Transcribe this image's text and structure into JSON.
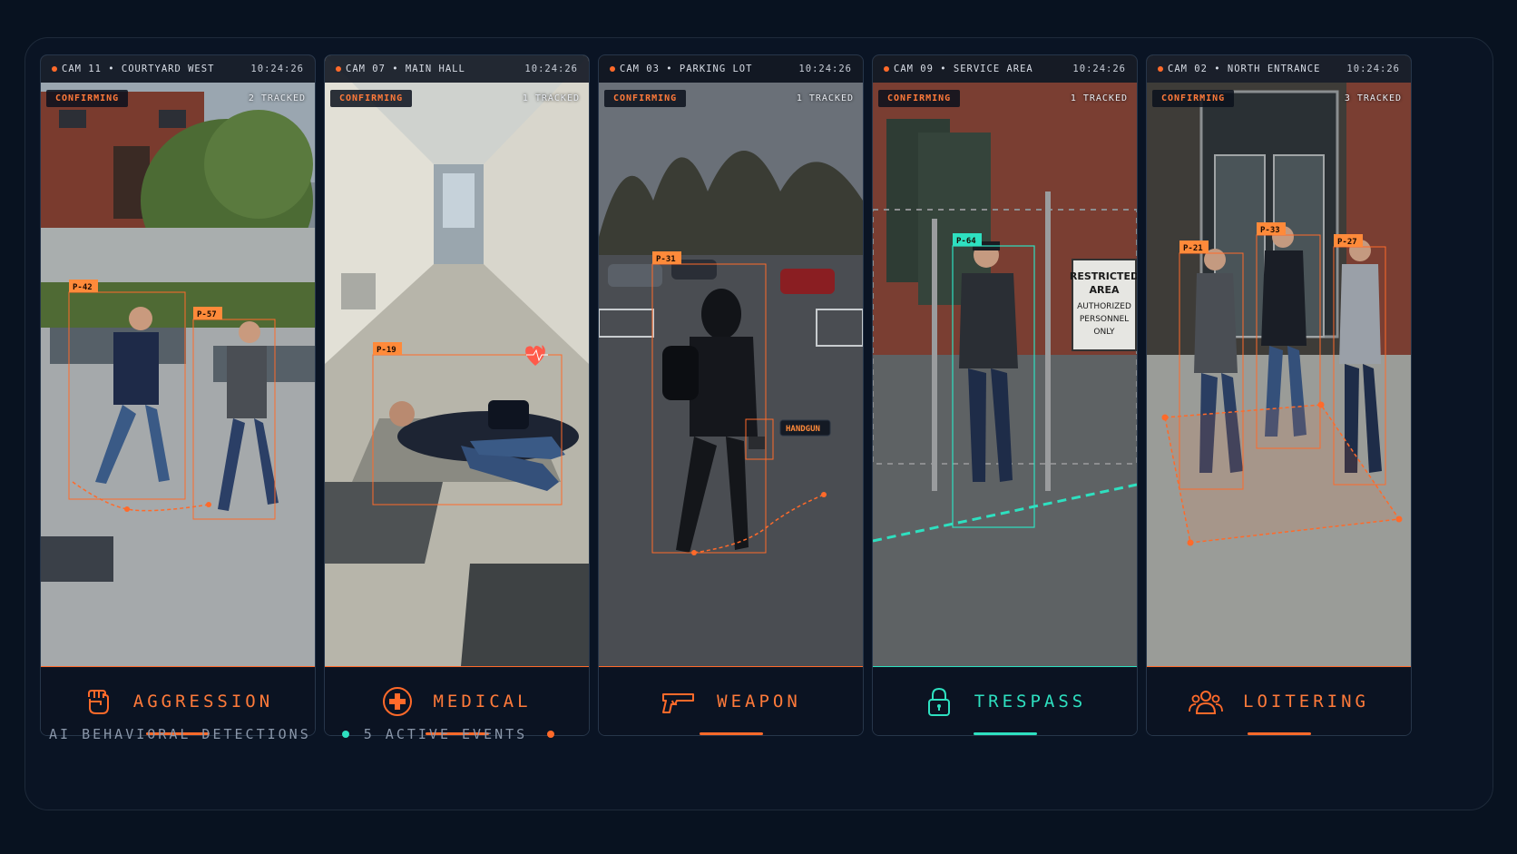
{
  "footer": {
    "title": "AI BEHAVIORAL DETECTIONS",
    "events": "5 ACTIVE EVENTS",
    "teal": "#2ee0c0",
    "orange": "#ff6a2a"
  },
  "panels": [
    {
      "camera": "CAM 11 • COURTYARD WEST",
      "time": "10:24:26",
      "status": "CONFIRMING",
      "tracked": "2 TRACKED",
      "label": "AGGRESSION",
      "icon": "fist-icon",
      "tags": [
        "P-42",
        "P-57"
      ]
    },
    {
      "camera": "CAM 07 • MAIN HALL",
      "time": "10:24:26",
      "status": "CONFIRMING",
      "tracked": "1 TRACKED",
      "label": "MEDICAL",
      "icon": "medical-cross-icon",
      "tags": [
        "P-19"
      ]
    },
    {
      "camera": "CAM 03 • PARKING LOT",
      "time": "10:24:26",
      "status": "CONFIRMING",
      "tracked": "1 TRACKED",
      "label": "WEAPON",
      "icon": "handgun-icon",
      "tags": [
        "P-31",
        "HANDGUN"
      ]
    },
    {
      "camera": "CAM 09 • SERVICE AREA",
      "time": "10:24:26",
      "status": "CONFIRMING",
      "tracked": "1 TRACKED",
      "label": "TRESPASS",
      "icon": "lock-icon",
      "tags": [
        "P-64"
      ],
      "sign": [
        "RESTRICTED",
        "AREA",
        "AUTHORIZED",
        "PERSONNEL",
        "ONLY"
      ]
    },
    {
      "camera": "CAM 02 • NORTH ENTRANCE",
      "time": "10:24:26",
      "status": "CONFIRMING",
      "tracked": "3 TRACKED",
      "label": "LOITERING",
      "icon": "group-icon",
      "tags": [
        "P-21",
        "P-33",
        "P-27"
      ]
    }
  ]
}
